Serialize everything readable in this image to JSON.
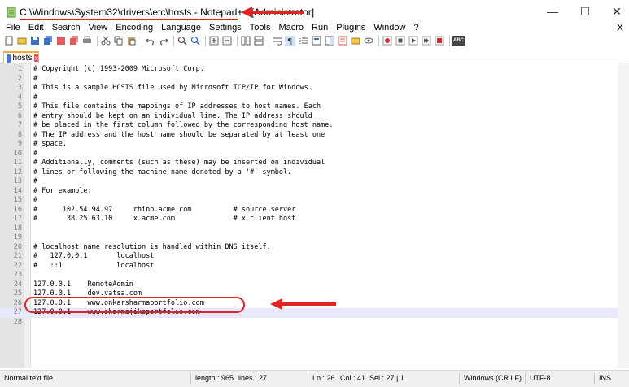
{
  "window": {
    "title": "C:\\Windows\\System32\\drivers\\etc\\hosts - Notepad++ [Administrator]",
    "minimize": "—",
    "maximize": "☐",
    "close": "✕"
  },
  "menu": {
    "items": [
      "File",
      "Edit",
      "Search",
      "View",
      "Encoding",
      "Language",
      "Settings",
      "Tools",
      "Macro",
      "Run",
      "Plugins",
      "Window",
      "?"
    ],
    "close": "X"
  },
  "toolbar": {
    "buttons": [
      "new-file",
      "open-file",
      "save",
      "save-all",
      "close",
      "close-all",
      "print",
      "cut",
      "copy",
      "paste",
      "undo",
      "redo",
      "find",
      "replace",
      "zoom-in",
      "zoom-out",
      "sync-vertical",
      "sync-horizontal",
      "word-wrap",
      "show-all-chars",
      "indent-guide",
      "user-defined-language",
      "document-map",
      "function-list",
      "folder-workspace",
      "monitoring",
      "record-macro",
      "stop-recording",
      "play-macro",
      "play-macro-multiple",
      "save-macro",
      "spell-check"
    ],
    "spell_check_label": "ABC"
  },
  "tab": {
    "label": "hosts",
    "close": "x"
  },
  "editor": {
    "lines": [
      {
        "n": "1",
        "text": "# Copyright (c) 1993-2009 Microsoft Corp."
      },
      {
        "n": "2",
        "text": "#"
      },
      {
        "n": "3",
        "text": "# This is a sample HOSTS file used by Microsoft TCP/IP for Windows."
      },
      {
        "n": "4",
        "text": "#"
      },
      {
        "n": "5",
        "text": "# This file contains the mappings of IP addresses to host names. Each"
      },
      {
        "n": "6",
        "text": "# entry should be kept on an individual line. The IP address should"
      },
      {
        "n": "7",
        "text": "# be placed in the first column followed by the corresponding host name."
      },
      {
        "n": "8",
        "text": "# The IP address and the host name should be separated by at least one"
      },
      {
        "n": "9",
        "text": "# space."
      },
      {
        "n": "10",
        "text": "#"
      },
      {
        "n": "11",
        "text": "# Additionally, comments (such as these) may be inserted on individual"
      },
      {
        "n": "12",
        "text": "# lines or following the machine name denoted by a '#' symbol."
      },
      {
        "n": "13",
        "text": "#"
      },
      {
        "n": "14",
        "text": "# For example:"
      },
      {
        "n": "15",
        "text": "#"
      },
      {
        "n": "16",
        "text": "#      102.54.94.97     rhino.acme.com          # source server"
      },
      {
        "n": "17",
        "text": "#       38.25.63.10     x.acme.com              # x client host"
      },
      {
        "n": "18",
        "text": ""
      },
      {
        "n": "19",
        "text": ""
      },
      {
        "n": "20",
        "text": "# localhost name resolution is handled within DNS itself."
      },
      {
        "n": "21",
        "text": "#   127.0.0.1       localhost"
      },
      {
        "n": "22",
        "text": "#   ::1             localhost"
      },
      {
        "n": "23",
        "text": ""
      },
      {
        "n": "24",
        "text": "127.0.0.1    RemoteAdmin"
      },
      {
        "n": "25",
        "text": "127.0.0.1    dev.vatsa.com"
      },
      {
        "n": "26",
        "text": "127.0.0.1    www.onkarsharmaportfolio.com"
      },
      {
        "n": "27",
        "text": "127.0.0.1    www.sharmajikaportfolio.com"
      },
      {
        "n": "28",
        "text": ""
      }
    ],
    "current_line_index": 26
  },
  "status": {
    "file_type": "Normal text file",
    "length": "length : 965",
    "lines": "lines : 27",
    "position": "Ln : 26",
    "column": "Col : 41",
    "selection": "Sel : 27 | 1",
    "eol": "Windows (CR LF)",
    "encoding": "UTF-8",
    "mode": "INS"
  },
  "colors": {
    "annotation": "#e02424",
    "current_line": "#e8e8ff",
    "gutter": "#e4e4e4"
  }
}
